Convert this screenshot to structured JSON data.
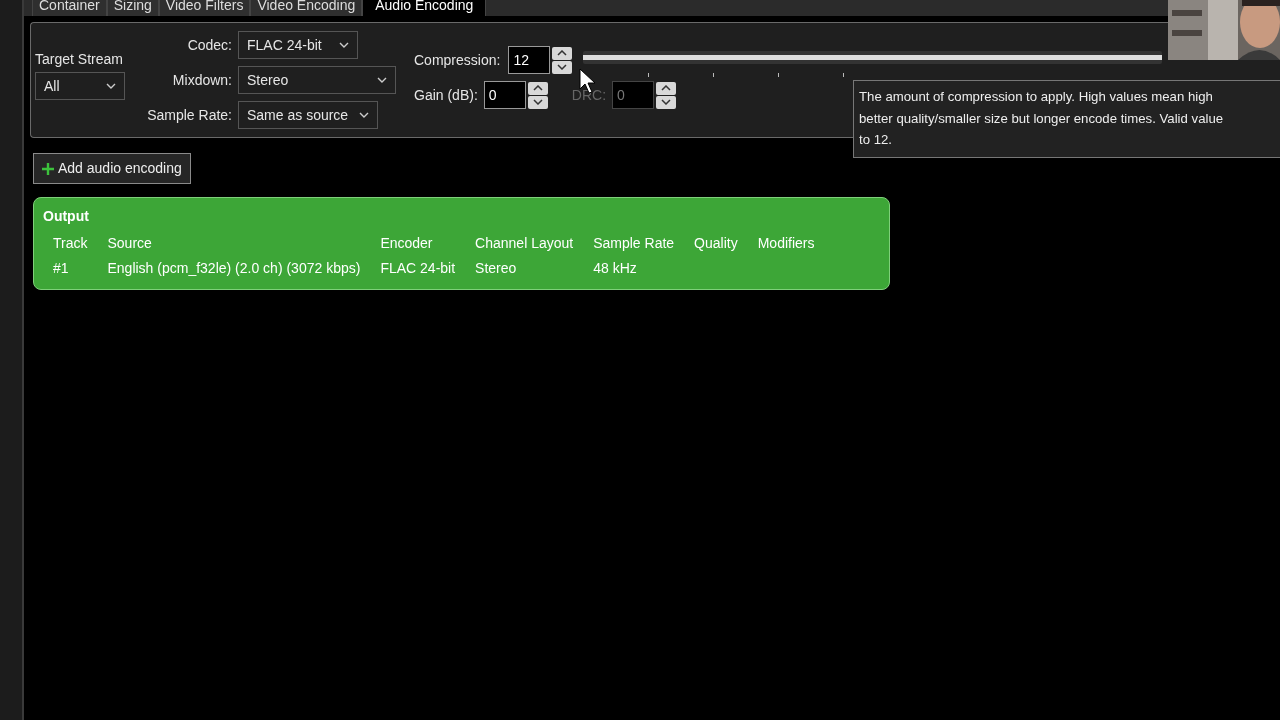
{
  "tabs": [
    {
      "label": "Container",
      "selected": false
    },
    {
      "label": "Sizing",
      "selected": false
    },
    {
      "label": "Video Filters",
      "selected": false
    },
    {
      "label": "Video Encoding",
      "selected": false
    },
    {
      "label": "Audio Encoding",
      "selected": true
    }
  ],
  "target_stream": {
    "label": "Target Stream",
    "value": "All"
  },
  "codec": {
    "label": "Codec:",
    "value": "FLAC 24-bit"
  },
  "mixdown": {
    "label": "Mixdown:",
    "value": "Stereo"
  },
  "sample_rate": {
    "label": "Sample Rate:",
    "value": "Same as source"
  },
  "compression": {
    "label": "Compression:",
    "value": "12",
    "level": 1
  },
  "gain": {
    "label": "Gain (dB):",
    "value": "0",
    "disabled": false
  },
  "drc": {
    "label": "DRC:",
    "value": "0",
    "disabled": true
  },
  "tooltip": {
    "lines": [
      "The amount of compression to apply. High values mean high",
      "better quality/smaller size but longer encode times. Valid value",
      "to 12."
    ]
  },
  "add_button": {
    "label": "Add audio encoding"
  },
  "output": {
    "title": "Output",
    "columns": [
      "Track",
      "Source",
      "Encoder",
      "Channel Layout",
      "Sample Rate",
      "Quality",
      "Modifiers"
    ],
    "rows": [
      [
        "#1",
        "English (pcm_f32le) (2.0 ch) (3072 kbps)",
        "FLAC 24-bit",
        "Stereo",
        "48 kHz"
      ]
    ]
  }
}
